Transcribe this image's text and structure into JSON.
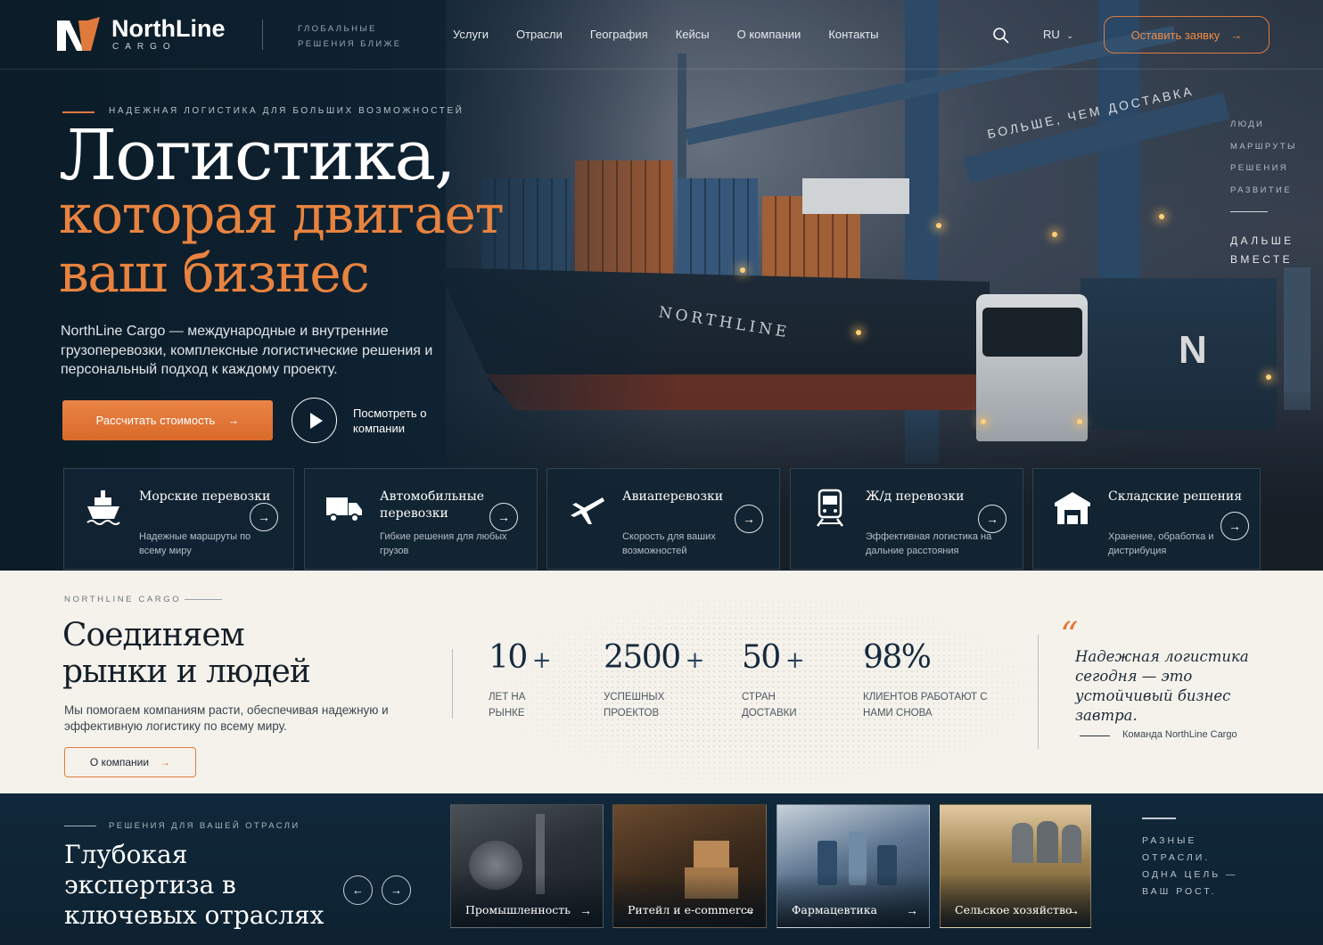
{
  "header": {
    "brand_name": "NorthLine",
    "brand_sub": "CARGO",
    "tagline": "ГЛОБАЛЬНЫЕ РЕШЕНИЯ БЛИЖЕ",
    "nav": [
      "Услуги",
      "Отрасли",
      "География",
      "Кейсы",
      "О компании",
      "Контакты"
    ],
    "search_icon": "search-icon",
    "lang": "RU",
    "cta_label": "Оставить заявку",
    "accent_color": "#e07a3c"
  },
  "hero": {
    "eyebrow": "НАДЕЖНАЯ ЛОГИСТИКА ДЛЯ БОЛЬШИХ ВОЗМОЖНОСТЕЙ",
    "title_line1": "Логистика,",
    "title_line2": "которая двигает",
    "title_line3": "ваш бизнес",
    "description": "NorthLine Cargo — международные и внутренние грузоперевозки, комплексные логистические решения и персональный подход к каждому проекту.",
    "primary_button": "Рассчитать стоимость",
    "video_label": "Посмотреть о компании",
    "image_ship_name": "NORTHLINE",
    "image_banner": "БОЛЬШЕ, ЧЕМ ДОСТАВКА",
    "side_list": [
      "ЛЮДИ",
      "МАРШРУТЫ",
      "РЕШЕНИЯ",
      "РАЗВИТИЕ"
    ],
    "side_more": "ДАЛЬШЕ ВМЕСТЕ"
  },
  "services": [
    {
      "icon": "ship-icon",
      "title": "Морские перевозки",
      "subtitle": "Надежные маршруты по всему миру"
    },
    {
      "icon": "truck-icon",
      "title": "Автомобильные перевозки",
      "subtitle": "Гибкие решения для любых грузов"
    },
    {
      "icon": "plane-icon",
      "title": "Авиаперевозки",
      "subtitle": "Скорость для ваших возможностей"
    },
    {
      "icon": "train-icon",
      "title": "Ж/д перевозки",
      "subtitle": "Эффективная логистика на дальние расстояния"
    },
    {
      "icon": "warehouse-icon",
      "title": "Складские решения",
      "subtitle": "Хранение, обработка и дистрибуция"
    }
  ],
  "about": {
    "eyebrow": "NORTHLINE CARGO",
    "title": "Соединяем рынки и людей",
    "description": "Мы помогаем компаниям расти, обеспечивая надежную и эффективную логистику по всему миру.",
    "button": "О компании",
    "stats": [
      {
        "value": "10",
        "suffix": "+",
        "label": "ЛЕТ НА РЫНКЕ"
      },
      {
        "value": "2500",
        "suffix": "+",
        "label": "УСПЕШНЫХ ПРОЕКТОВ"
      },
      {
        "value": "50",
        "suffix": "+",
        "label": "СТРАН ДОСТАВКИ"
      },
      {
        "value": "98%",
        "suffix": "",
        "label": "КЛИЕНТОВ РАБОТАЮТ С НАМИ СНОВА"
      }
    ],
    "quote_mark": "“",
    "quote": "Надежная логистика сегодня — это устойчивый бизнес завтра.",
    "quote_author": "Команда NorthLine Cargo"
  },
  "industries": {
    "eyebrow": "РЕШЕНИЯ ДЛЯ ВАШЕЙ ОТРАСЛИ",
    "title": "Глубокая экспертиза в ключевых отраслях",
    "prev_icon": "arrow-left-icon",
    "next_icon": "arrow-right-icon",
    "tiles": [
      "Промышленность",
      "Ритейл и e-commerce",
      "Фармацевтика",
      "Сельское хозяйство"
    ],
    "side_text": "РАЗНЫЕ ОТРАСЛИ. ОДНА ЦЕЛЬ — ВАШ РОСТ."
  }
}
